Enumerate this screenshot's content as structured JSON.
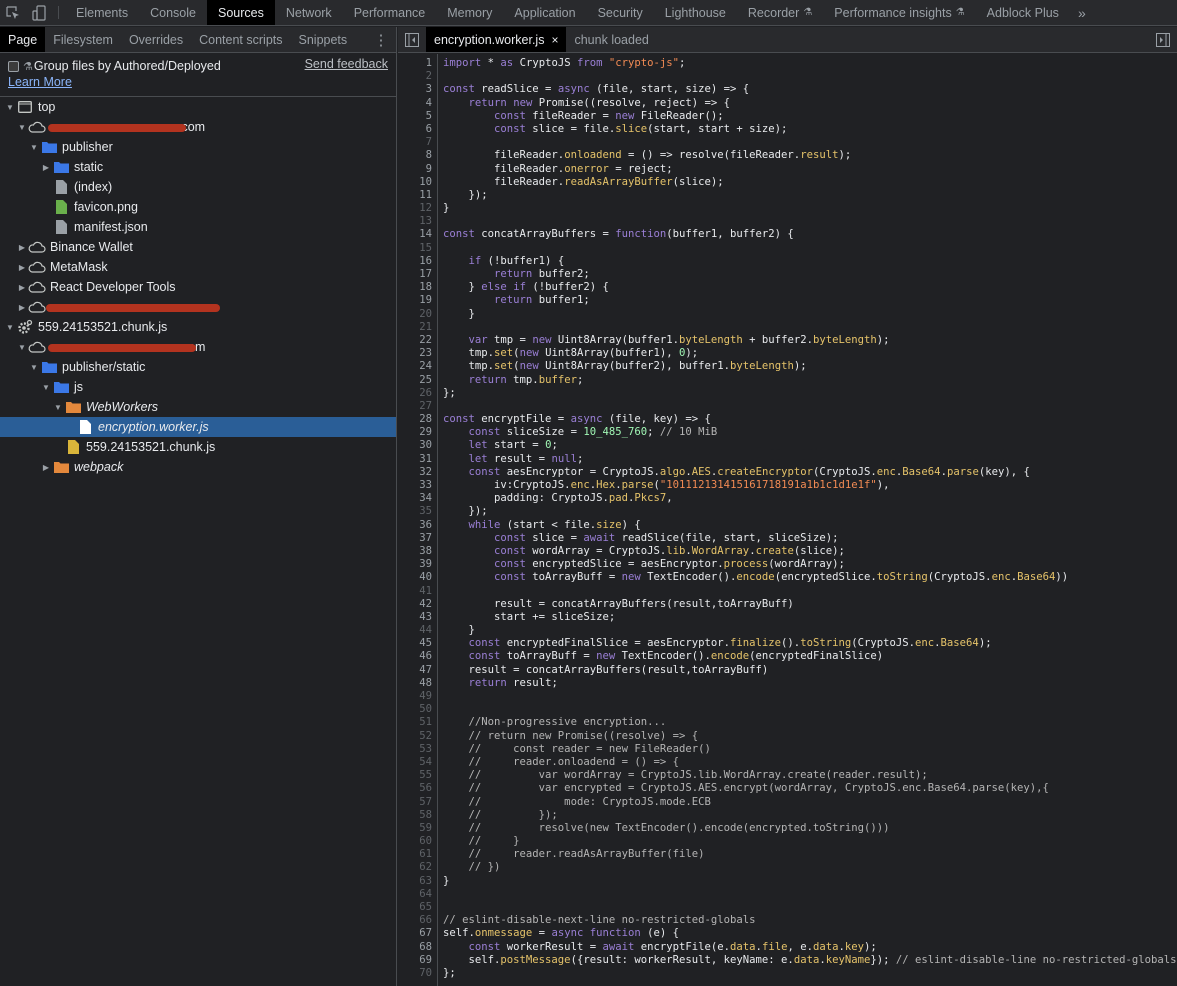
{
  "toolbar": {
    "inspect_icon": "inspect-element-icon",
    "device_icon": "device-toolbar-icon",
    "tabs": [
      {
        "label": "Elements",
        "active": false,
        "experimental": false
      },
      {
        "label": "Console",
        "active": false,
        "experimental": false
      },
      {
        "label": "Sources",
        "active": true,
        "experimental": false
      },
      {
        "label": "Network",
        "active": false,
        "experimental": false
      },
      {
        "label": "Performance",
        "active": false,
        "experimental": false
      },
      {
        "label": "Memory",
        "active": false,
        "experimental": false
      },
      {
        "label": "Application",
        "active": false,
        "experimental": false
      },
      {
        "label": "Security",
        "active": false,
        "experimental": false
      },
      {
        "label": "Lighthouse",
        "active": false,
        "experimental": false
      },
      {
        "label": "Recorder",
        "active": false,
        "experimental": true
      },
      {
        "label": "Performance insights",
        "active": false,
        "experimental": true
      },
      {
        "label": "Adblock Plus",
        "active": false,
        "experimental": false
      }
    ],
    "more_label": "»"
  },
  "navigator": {
    "tabs": [
      {
        "label": "Page",
        "active": true
      },
      {
        "label": "Filesystem",
        "active": false
      },
      {
        "label": "Overrides",
        "active": false
      },
      {
        "label": "Content scripts",
        "active": false
      },
      {
        "label": "Snippets",
        "active": false
      }
    ],
    "more_label": "⋮",
    "group_checkbox_label": "Group files by Authored/Deployed",
    "group_checkbox_checked": false,
    "send_feedback": "Send feedback",
    "learn_more": "Learn More",
    "tree": [
      {
        "label": "top",
        "depth": 0,
        "arrow": "down",
        "icon": "frame",
        "italic": false,
        "selected": false
      },
      {
        "label": ".com",
        "depth": 1,
        "arrow": "down",
        "icon": "cloud",
        "italic": false,
        "selected": false,
        "redacted": true
      },
      {
        "label": "publisher",
        "depth": 2,
        "arrow": "down",
        "icon": "folder-blue",
        "italic": false,
        "selected": false
      },
      {
        "label": "static",
        "depth": 3,
        "arrow": "right",
        "icon": "folder-blue",
        "italic": false,
        "selected": false
      },
      {
        "label": "(index)",
        "depth": 3,
        "arrow": "",
        "icon": "file-gray",
        "italic": false,
        "selected": false
      },
      {
        "label": "favicon.png",
        "depth": 3,
        "arrow": "",
        "icon": "file-green",
        "italic": false,
        "selected": false
      },
      {
        "label": "manifest.json",
        "depth": 3,
        "arrow": "",
        "icon": "file-gray",
        "italic": false,
        "selected": false
      },
      {
        "label": "Binance Wallet",
        "depth": 1,
        "arrow": "right",
        "icon": "cloud",
        "italic": false,
        "selected": false
      },
      {
        "label": "MetaMask",
        "depth": 1,
        "arrow": "right",
        "icon": "cloud",
        "italic": false,
        "selected": false
      },
      {
        "label": "React Developer Tools",
        "depth": 1,
        "arrow": "right",
        "icon": "cloud",
        "italic": false,
        "selected": false
      },
      {
        "label": "",
        "depth": 1,
        "arrow": "right",
        "icon": "cloud",
        "italic": false,
        "selected": false,
        "redacted": true
      },
      {
        "label": "559.24153521.chunk.js",
        "depth": 0,
        "arrow": "down",
        "icon": "gear",
        "italic": false,
        "selected": false
      },
      {
        "label": "om",
        "depth": 1,
        "arrow": "down",
        "icon": "cloud",
        "italic": false,
        "selected": false,
        "redacted": true
      },
      {
        "label": "publisher/static",
        "depth": 2,
        "arrow": "down",
        "icon": "folder-blue",
        "italic": false,
        "selected": false
      },
      {
        "label": "js",
        "depth": 3,
        "arrow": "down",
        "icon": "folder-blue",
        "italic": false,
        "selected": false
      },
      {
        "label": "WebWorkers",
        "depth": 4,
        "arrow": "down",
        "icon": "folder-orange",
        "italic": true,
        "selected": false
      },
      {
        "label": "encryption.worker.js",
        "depth": 5,
        "arrow": "",
        "icon": "file-white",
        "italic": true,
        "selected": true
      },
      {
        "label": "559.24153521.chunk.js",
        "depth": 4,
        "arrow": "",
        "icon": "file-yellow",
        "italic": false,
        "selected": false
      },
      {
        "label": "webpack",
        "depth": 3,
        "arrow": "right",
        "icon": "folder-orange",
        "italic": true,
        "selected": false
      }
    ]
  },
  "editor": {
    "tabs": [
      {
        "label": "encryption.worker.js",
        "active": true,
        "closable": true
      },
      {
        "label": "chunk loaded",
        "active": false,
        "closable": false
      }
    ],
    "close_label": "×",
    "lines": [
      "import * as CryptoJS from \"crypto-js\";",
      "",
      "const readSlice = async (file, start, size) => {",
      "    return new Promise((resolve, reject) => {",
      "        const fileReader = new FileReader();",
      "        const slice = file.slice(start, start + size);",
      "",
      "        fileReader.onloadend = () => resolve(fileReader.result);",
      "        fileReader.onerror = reject;",
      "        fileReader.readAsArrayBuffer(slice);",
      "    });",
      "}",
      "",
      "const concatArrayBuffers = function(buffer1, buffer2) {",
      "",
      "    if (!buffer1) {",
      "        return buffer2;",
      "    } else if (!buffer2) {",
      "        return buffer1;",
      "    }",
      "",
      "    var tmp = new Uint8Array(buffer1.byteLength + buffer2.byteLength);",
      "    tmp.set(new Uint8Array(buffer1), 0);",
      "    tmp.set(new Uint8Array(buffer2), buffer1.byteLength);",
      "    return tmp.buffer;",
      "};",
      "",
      "const encryptFile = async (file, key) => {",
      "    const sliceSize = 10_485_760; // 10 MiB",
      "    let start = 0;",
      "    let result = null;",
      "    const aesEncryptor = CryptoJS.algo.AES.createEncryptor(CryptoJS.enc.Base64.parse(key), {",
      "        iv:CryptoJS.enc.Hex.parse(\"101112131415161718191a1b1c1d1e1f\"),",
      "        padding: CryptoJS.pad.Pkcs7,",
      "    });",
      "    while (start < file.size) {",
      "        const slice = await readSlice(file, start, sliceSize);",
      "        const wordArray = CryptoJS.lib.WordArray.create(slice);",
      "        const encryptedSlice = aesEncryptor.process(wordArray);",
      "        const toArrayBuff = new TextEncoder().encode(encryptedSlice.toString(CryptoJS.enc.Base64))",
      "",
      "        result = concatArrayBuffers(result,toArrayBuff)",
      "        start += sliceSize;",
      "    }",
      "    const encryptedFinalSlice = aesEncryptor.finalize().toString(CryptoJS.enc.Base64);",
      "    const toArrayBuff = new TextEncoder().encode(encryptedFinalSlice)",
      "    result = concatArrayBuffers(result,toArrayBuff)",
      "    return result;",
      "",
      "",
      "    //Non-progressive encryption...",
      "    // return new Promise((resolve) => {",
      "    //     const reader = new FileReader()",
      "    //     reader.onloadend = () => {",
      "    //         var wordArray = CryptoJS.lib.WordArray.create(reader.result);",
      "    //         var encrypted = CryptoJS.AES.encrypt(wordArray, CryptoJS.enc.Base64.parse(key),{",
      "    //             mode: CryptoJS.mode.ECB",
      "    //         });",
      "    //         resolve(new TextEncoder().encode(encrypted.toString()))",
      "    //     }",
      "    //     reader.readAsArrayBuffer(file)",
      "    // })",
      "}",
      "",
      "",
      "// eslint-disable-next-line no-restricted-globals",
      "self.onmessage = async function (e) {",
      "    const workerResult = await encryptFile(e.data.file, e.data.key);",
      "    self.postMessage({result: workerResult, keyName: e.data.keyName}); // eslint-disable-line no-restricted-globals",
      "};"
    ],
    "dim_line_numbers": [
      2,
      7,
      12,
      13,
      15,
      20,
      21,
      26,
      27,
      35,
      41,
      44,
      49,
      50,
      51,
      52,
      53,
      54,
      55,
      56,
      57,
      58,
      59,
      60,
      61,
      62,
      63,
      64,
      65,
      66,
      70
    ]
  },
  "colors": {
    "accent_selected": "#2a5e97",
    "keyword": "#9a7fd5",
    "string": "#f28b54",
    "property": "#e5c36a",
    "number": "#a1f7b5",
    "comment": "#b4b4b4",
    "link": "#8ab4f8"
  }
}
